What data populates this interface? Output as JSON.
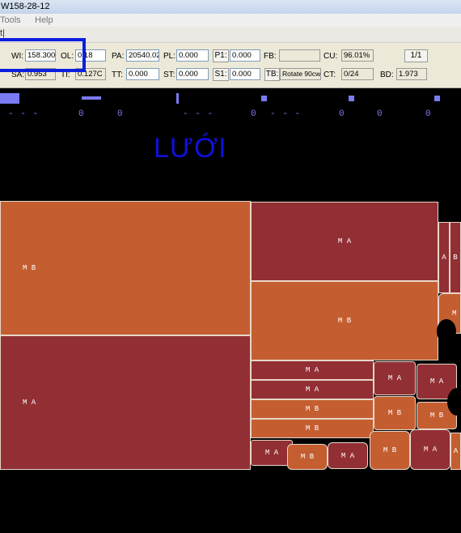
{
  "window": {
    "title": "W158-28-12"
  },
  "menu": [
    "Tools",
    "Help"
  ],
  "toolbar": {
    "text": "t|"
  },
  "params": {
    "row1": [
      {
        "label": "WI:",
        "value": "158.300"
      },
      {
        "label": "OL:",
        "value": "0.18"
      },
      {
        "label": "PA:",
        "value": "20540.02"
      },
      {
        "label": "PL:",
        "value": "0.000"
      },
      {
        "label": "P1:",
        "value": "0.000"
      },
      {
        "label": "FB:",
        "value": ""
      },
      {
        "label": "CU:",
        "value": "96.01%"
      }
    ],
    "row2": [
      {
        "label": "SA:",
        "value": "0.953"
      },
      {
        "label": "TI:",
        "value": "0.127C"
      },
      {
        "label": "TT:",
        "value": "0.000"
      },
      {
        "label": "ST:",
        "value": "0.000"
      },
      {
        "label": "S1:",
        "value": "0.000"
      },
      {
        "label": "TB:",
        "value": "Rotate 90cw"
      },
      {
        "label": "CT:",
        "value": "0/24"
      },
      {
        "label": "BD:",
        "value": "1.973"
      }
    ],
    "page_button": "1/1"
  },
  "canvas": {
    "overlay_label": "LƯỚI",
    "digits": [
      "0",
      "0",
      "0",
      "0",
      "0",
      "0"
    ],
    "dashes": [
      "- - -",
      "- - -",
      "- - -"
    ],
    "pieces": {
      "big_top": "M B",
      "big_bottom": "M A",
      "mid_top": "M A",
      "mid_bottom": "M B",
      "row1": "M A",
      "row2": "M A",
      "row3": "M B",
      "row4": "M B",
      "side_a": "A",
      "side_b": "B",
      "side_m": "M",
      "small1": "M A",
      "small2": "M A",
      "small3": "M B",
      "small4": "M B",
      "bot1": "M A",
      "bot2": "M B",
      "bot3": "M A",
      "bot4": "M B",
      "bot5": "M A",
      "bot6": "A"
    }
  },
  "colors": {
    "orange_piece": "#c45e31",
    "red_piece": "#922f34",
    "marker_blue": "#7b7bf2",
    "highlight": "#0b1ee0"
  }
}
